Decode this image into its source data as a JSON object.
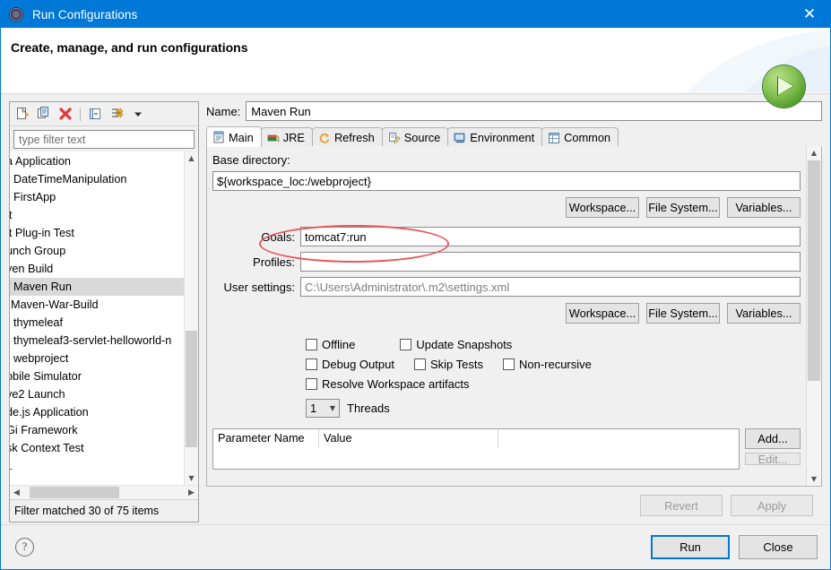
{
  "window": {
    "title": "Run Configurations",
    "icon": "launch-config-icon",
    "close_label": "✕"
  },
  "header": {
    "title": "Create, manage, and run configurations",
    "badge_icon": "green-run-play-icon"
  },
  "tree_panel": {
    "toolbar": [
      {
        "name": "new-configuration-icon",
        "label": "New"
      },
      {
        "name": "duplicate-configuration-icon",
        "label": "Duplicate"
      },
      {
        "name": "delete-configuration-icon",
        "label": "Delete"
      },
      {
        "name": "collapse-all-icon",
        "label": "Collapse All"
      },
      {
        "name": "filter-configurations-icon",
        "label": "Filter"
      },
      {
        "name": "view-menu-chevron-icon",
        "label": "View Menu"
      }
    ],
    "filter_placeholder": "type filter text",
    "filter_value": "",
    "items": [
      {
        "label": "a Application",
        "selected": false
      },
      {
        "label": "DateTimeManipulation",
        "selected": false,
        "indent": true
      },
      {
        "label": "FirstApp",
        "selected": false,
        "indent": true
      },
      {
        "label": "it",
        "selected": false
      },
      {
        "label": "it Plug-in Test",
        "selected": false
      },
      {
        "label": "unch Group",
        "selected": false
      },
      {
        "label": "ven Build",
        "selected": false
      },
      {
        "label": "Maven Run",
        "selected": true
      },
      {
        "label": "Maven-War-Build",
        "selected": false
      },
      {
        "label": "thymeleaf",
        "selected": false
      },
      {
        "label": "thymeleaf3-servlet-helloworld-n",
        "selected": false
      },
      {
        "label": "webproject",
        "selected": false
      },
      {
        "label": "obile Simulator",
        "selected": false
      },
      {
        "label": "ve2 Launch",
        "selected": false
      },
      {
        "label": "de.js Application",
        "selected": false
      },
      {
        "label": "Gi Framework",
        "selected": false
      },
      {
        "label": "sk Context Test",
        "selected": false
      },
      {
        "label": "L",
        "selected": false,
        "blue": true
      }
    ],
    "status": "Filter matched 30 of 75 items"
  },
  "config": {
    "name_label": "Name:",
    "name_value": "Maven Run",
    "tabs": [
      {
        "label": "Main",
        "icon": "main-tab-icon",
        "active": true
      },
      {
        "label": "JRE",
        "icon": "jre-tab-icon",
        "active": false
      },
      {
        "label": "Refresh",
        "icon": "refresh-tab-icon",
        "active": false
      },
      {
        "label": "Source",
        "icon": "source-tab-icon",
        "active": false
      },
      {
        "label": "Environment",
        "icon": "environment-tab-icon",
        "active": false
      },
      {
        "label": "Common",
        "icon": "common-tab-icon",
        "active": false
      }
    ],
    "main_tab": {
      "base_directory_label": "Base directory:",
      "base_directory_value": "${workspace_loc:/webproject}",
      "browse_buttons_top": [
        {
          "label": "Workspace..."
        },
        {
          "label": "File System..."
        },
        {
          "label": "Variables..."
        }
      ],
      "goals_label": "Goals:",
      "goals_value": "tomcat7:run",
      "profiles_label": "Profiles:",
      "profiles_value": "",
      "user_settings_label": "User settings:",
      "user_settings_value": "C:\\Users\\Administrator\\.m2\\settings.xml",
      "browse_buttons_bottom": [
        {
          "label": "Workspace..."
        },
        {
          "label": "File System..."
        },
        {
          "label": "Variables..."
        }
      ],
      "checkboxes": [
        {
          "label": "Offline",
          "checked": false
        },
        {
          "label": "Update Snapshots",
          "checked": false
        },
        {
          "label": "Debug Output",
          "checked": false
        },
        {
          "label": "Skip Tests",
          "checked": false
        },
        {
          "label": "Non-recursive",
          "checked": false
        },
        {
          "label": "Resolve Workspace artifacts",
          "checked": false
        }
      ],
      "threads_value": "1",
      "threads_label": "Threads",
      "parameter_table": {
        "columns": [
          "Parameter Name",
          "Value",
          ""
        ],
        "rows": []
      },
      "table_buttons": [
        {
          "label": "Add...",
          "enabled": true
        },
        {
          "label": "Edit...",
          "enabled": false
        }
      ]
    },
    "revert_label": "Revert",
    "apply_label": "Apply",
    "revert_enabled": false,
    "apply_enabled": false
  },
  "footer": {
    "help_icon": "help-question-icon",
    "run_label": "Run",
    "close_label": "Close"
  },
  "annotation": {
    "type": "red-ellipse",
    "target": "goals-field"
  },
  "colors": {
    "titlebar": "#0078d7",
    "accent": "#0078d7",
    "annotation": "#e8565a",
    "run_badge_green": "#4e9a2a",
    "dialog_bg": "#f0f0f0"
  }
}
